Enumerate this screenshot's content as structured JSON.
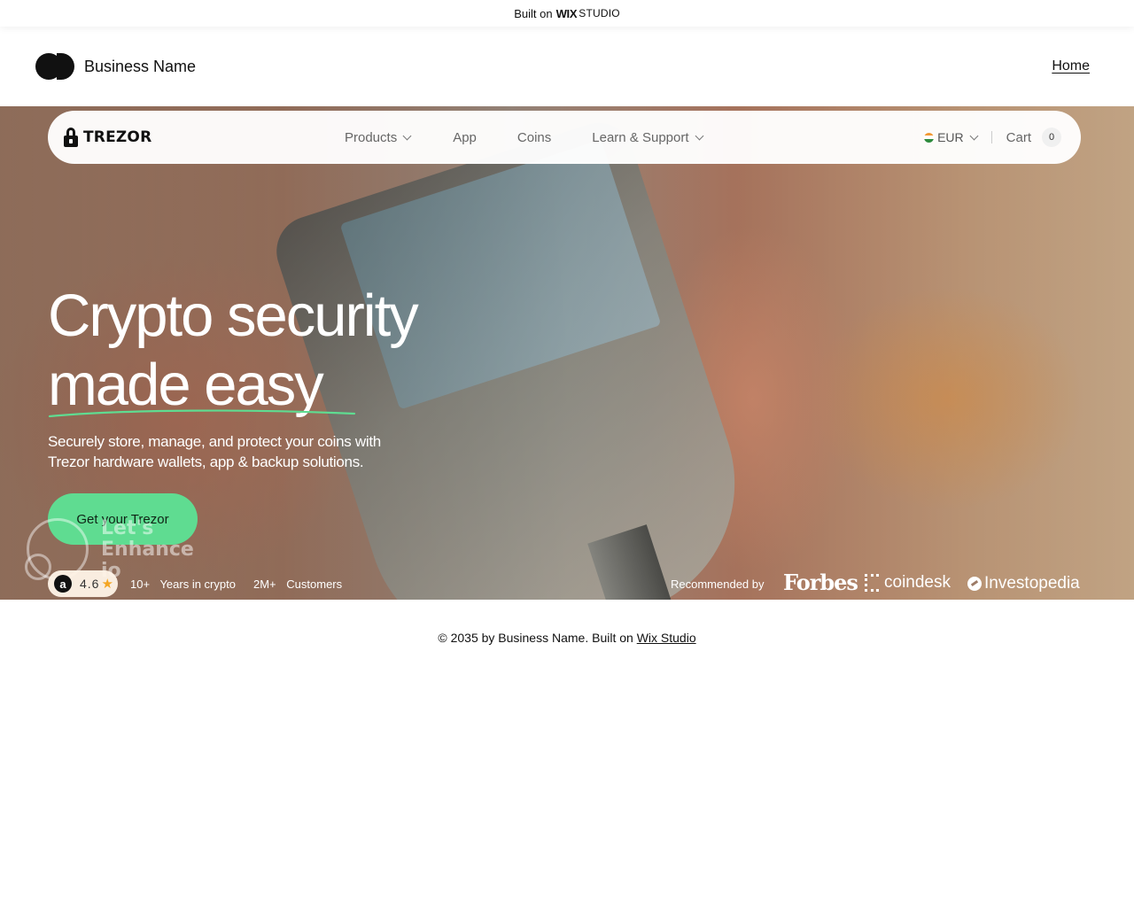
{
  "wix_banner": {
    "prefix": "Built on",
    "brand": "WIX",
    "product": "STUDIO"
  },
  "site_header": {
    "business_name": "Business Name",
    "nav_home": "Home"
  },
  "trezor_nav": {
    "logo_text": "TREZOR",
    "menu": [
      {
        "label": "Products",
        "has_dropdown": true
      },
      {
        "label": "App",
        "has_dropdown": false
      },
      {
        "label": "Coins",
        "has_dropdown": false
      },
      {
        "label": "Learn & Support",
        "has_dropdown": true
      }
    ],
    "currency": "EUR",
    "cart_label": "Cart",
    "cart_count": "0"
  },
  "hero": {
    "title_line1": "Crypto security",
    "title_line2": "made easy",
    "subtitle_line1": "Securely store, manage, and protect your coins with",
    "subtitle_line2": "Trezor hardware wallets, app & backup solutions.",
    "cta_label": "Get your Trezor",
    "rating": "4.6",
    "stats": [
      {
        "number": "10+",
        "label": "Years in crypto"
      },
      {
        "number": "2M+",
        "label": "Customers"
      }
    ],
    "recommended_label": "Recommended by",
    "press": [
      "Forbes",
      "coindesk",
      "Investopedia"
    ]
  },
  "watermark": {
    "line1": "Let's",
    "line2": "Enhance",
    "line3": "io"
  },
  "footer": {
    "text": "© 2035 by Business Name. Built on",
    "link": "Wix Studio"
  },
  "colors": {
    "cta": "#5fdc91",
    "underline": "#5fdc91",
    "star": "#f4a623"
  }
}
